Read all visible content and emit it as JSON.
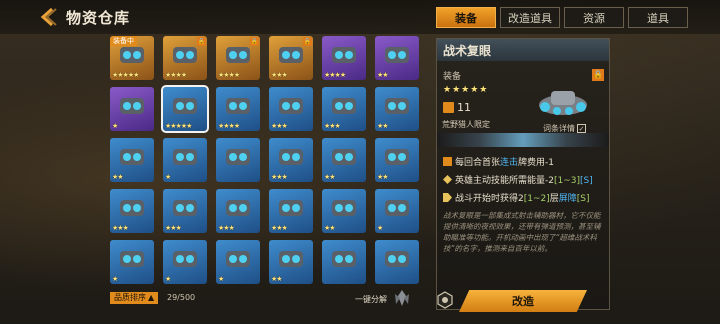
{
  "header": {
    "title": "物资仓库"
  },
  "tabs": [
    {
      "label": "装备",
      "active": true
    },
    {
      "label": "改造道具",
      "active": false
    },
    {
      "label": "资源",
      "active": false
    },
    {
      "label": "道具",
      "active": false
    }
  ],
  "grid": {
    "items": [
      {
        "rarity": "gold",
        "stars": "★★★★★",
        "equipped_label": "装备中",
        "selected": false
      },
      {
        "rarity": "gold",
        "stars": "★★★★",
        "lock": true
      },
      {
        "rarity": "gold",
        "stars": "★★★★",
        "lock": true
      },
      {
        "rarity": "gold",
        "stars": "★★★",
        "lock": true
      },
      {
        "rarity": "purple",
        "stars": "★★★★"
      },
      {
        "rarity": "purple",
        "stars": "★★"
      },
      {
        "rarity": "purple",
        "stars": "★"
      },
      {
        "rarity": "blue",
        "stars": "★★★★★",
        "selected": true
      },
      {
        "rarity": "blue",
        "stars": "★★★★"
      },
      {
        "rarity": "blue",
        "stars": "★★★"
      },
      {
        "rarity": "blue",
        "stars": "★★★"
      },
      {
        "rarity": "blue",
        "stars": "★★"
      },
      {
        "rarity": "blue",
        "stars": "★★"
      },
      {
        "rarity": "blue",
        "stars": "★"
      },
      {
        "rarity": "blue",
        "stars": ""
      },
      {
        "rarity": "blue",
        "stars": "★★★"
      },
      {
        "rarity": "blue",
        "stars": "★★"
      },
      {
        "rarity": "blue",
        "stars": "★★"
      },
      {
        "rarity": "blue",
        "stars": "★★★"
      },
      {
        "rarity": "blue",
        "stars": "★★★"
      },
      {
        "rarity": "blue",
        "stars": "★★★"
      },
      {
        "rarity": "blue",
        "stars": "★★★"
      },
      {
        "rarity": "blue",
        "stars": "★★"
      },
      {
        "rarity": "blue",
        "stars": "★"
      },
      {
        "rarity": "blue",
        "stars": "★"
      },
      {
        "rarity": "blue",
        "stars": "★"
      },
      {
        "rarity": "blue",
        "stars": "★"
      },
      {
        "rarity": "blue",
        "stars": "★★"
      },
      {
        "rarity": "blue",
        "stars": ""
      },
      {
        "rarity": "blue",
        "stars": ""
      }
    ]
  },
  "detail": {
    "name": "战术复眼",
    "type": "装备",
    "stars": "★★★★★",
    "cost": "11",
    "limit": "荒野猎人限定",
    "detail_label": "词条详情",
    "effects": [
      {
        "parts": [
          {
            "t": "每回合首张",
            "c": ""
          },
          {
            "t": "连击",
            "c": "hl"
          },
          {
            "t": "牌费用-1",
            "c": ""
          }
        ]
      },
      {
        "parts": [
          {
            "t": "英雄主动技能所需能量-2",
            "c": ""
          },
          {
            "t": "[1~3]",
            "c": "hg"
          },
          {
            "t": "[S]",
            "c": "hl"
          }
        ]
      },
      {
        "parts": [
          {
            "t": "战斗开始时获得2",
            "c": ""
          },
          {
            "t": "[1~2]",
            "c": "hg"
          },
          {
            "t": "层",
            "c": ""
          },
          {
            "t": "屏障",
            "c": "hl"
          },
          {
            "t": "[S]",
            "c": "hg"
          }
        ]
      }
    ],
    "description": "战术复眼是一部集成式射击辅助器材，它不仅能提供清晰的夜视效果，还带有弹道预测，甚至辅助瞄准等功能。开机动画中出现了“超维战术科技”的名字，推测来自百年以前。"
  },
  "footer": {
    "sort_label": "品质排序",
    "count": "29/500",
    "decompose_label": "一键分解",
    "remake_label": "改造"
  },
  "colors": {
    "accent": "#e08b1c",
    "highlight_blue": "#4fb7f2",
    "highlight_green": "#a8d06a"
  }
}
